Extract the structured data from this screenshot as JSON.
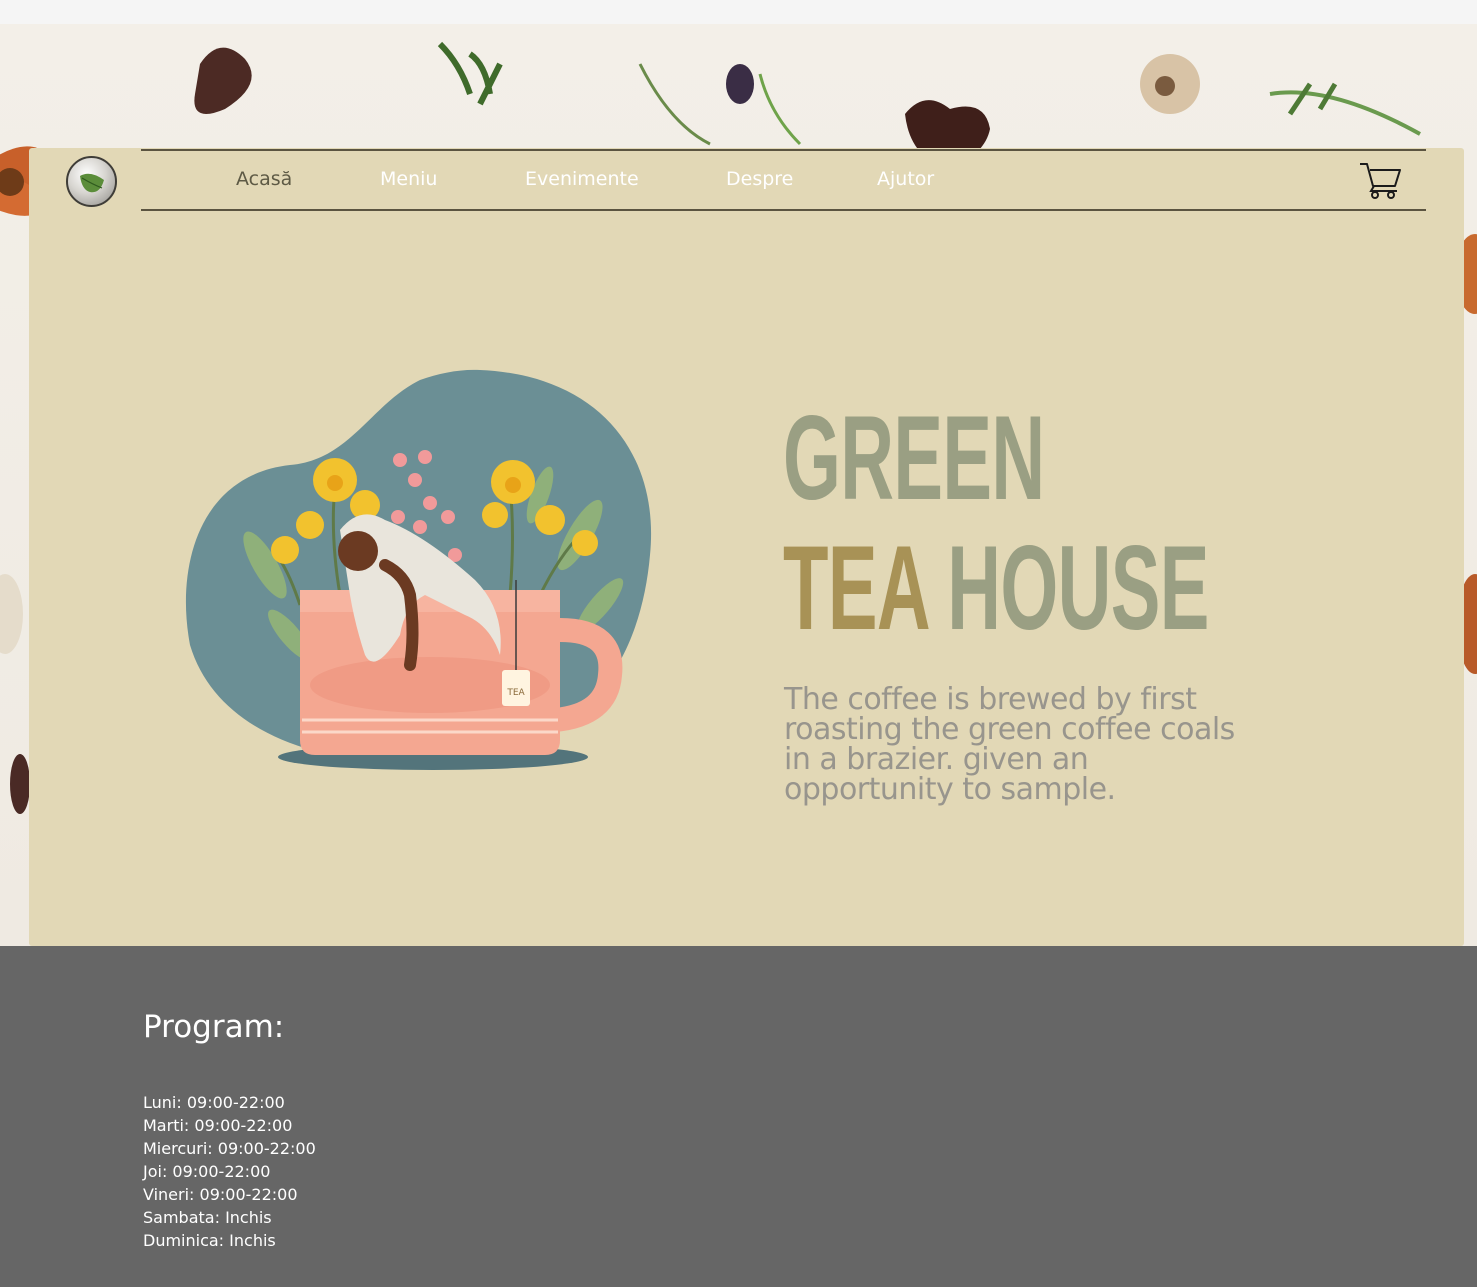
{
  "nav": {
    "items": [
      {
        "label": "Acasă",
        "active": true
      },
      {
        "label": "Meniu",
        "active": false
      },
      {
        "label": "Evenimente",
        "active": false
      },
      {
        "label": "Despre",
        "active": false
      },
      {
        "label": "Ajutor",
        "active": false
      }
    ],
    "cart_icon": "shopping-cart-icon",
    "logo_icon": "leaf-icon"
  },
  "hero": {
    "title_line1": "GREEN",
    "title_line2_accent": "TEA",
    "title_line2_rest": "HOUSE",
    "description": "The coffee is brewed by first roasting the green coffee coals in a brazier. given an opportunity to sample.",
    "illustration_tag": "TEA"
  },
  "footer": {
    "title": "Program:",
    "hours": [
      "Luni: 09:00-22:00",
      "Marti: 09:00-22:00",
      "Miercuri: 09:00-22:00",
      "Joi: 09:00-22:00",
      "Vineri: 09:00-22:00",
      "Sambata: Inchis",
      "Duminica: Inchis"
    ]
  },
  "colors": {
    "card_bg": "#e2d8b6",
    "title_green": "#9a9f83",
    "title_tea": "#a89256",
    "footer_bg": "#666666",
    "nav_active": "#5e5a45"
  }
}
